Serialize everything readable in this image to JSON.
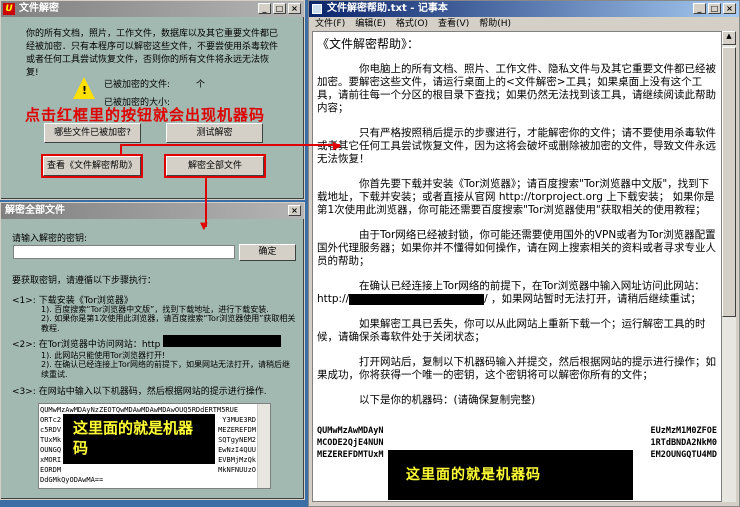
{
  "decryptor": {
    "title": "文件解密",
    "intro": "你的所有文档，照片，工作文件，数据库以及其它重要文件都已经被加密．只有本程序可以解密这些文件，不要尝使用杀毒软件或者任何工具尝试恢复文件，否则你的所有文件将永远无法恢复!",
    "files_label": "已被加密的文件:",
    "files_unit": "个",
    "size_label": "已被加密的大小:",
    "annotation": "点击红框里的按钮就会出现机器码",
    "btn_which": "哪些文件已被加密?",
    "btn_test": "测试解密",
    "btn_help": "查看《文件解密帮助》",
    "btn_decrypt_all": "解密全部文件"
  },
  "dialog": {
    "title": "解密全部文件",
    "key_label": "请输入解密的密钥:",
    "key_value": "",
    "ok": "确定",
    "steps_intro": "要获取密钥，请遵循以下步骤执行：",
    "step1": "<1>:  下载安装《Tor浏览器》",
    "step1_1": "1).  百度搜索“Tor浏览器中文版”，找到下载地址，进行下载安装.",
    "step1_2": "2).  如果你是第1次使用此浏览器，请百度搜索“Tor浏览器使用”获取相关教程.",
    "step2": "<2>:  在Tor浏览器中访问网站：http",
    "step2_1": "1).  此网站只能使用Tor浏览器打开!",
    "step2_2": "2).  在确认已经连接上Tor网络的前提下，如果网站无法打开，请稍后继续重试.",
    "step3": "<3>:  在网站中输入以下机器码，然后根据网站的提示进行操作.",
    "code_lines": [
      "QUMwMzAwMDAyNzZEOTQwMDAwMDAwMDAwOUQ5RDdERTM5RUE",
      "ORTc2",
      "c5RDV",
      "TUxMk",
      "OUNGQ",
      "xMORI",
      "EORDM",
      "DdGMkQyODAwMA=="
    ],
    "code_tail": [
      "Y3MUE3RD",
      "MEZEREFDM",
      "SQTgyNEM2",
      "EwNzI4QUU",
      "EVBMjMzQk",
      "MkNFNUUzO"
    ],
    "annotation": "这里面的就是机器码"
  },
  "notepad": {
    "title": "文件解密帮助.txt - 记事本",
    "menu": [
      "文件(F)",
      "编辑(E)",
      "格式(O)",
      "查看(V)",
      "帮助(H)"
    ],
    "heading": "《文件解密帮助》：",
    "p1": "你电脑上的所有文档、照片、工作文件、隐私文件与及其它重要文件都已经被加密。要解密这些文件，请运行桌面上的<文件解密>工具；如果桌面上没有这个工具，请前往每一个分区的根目录下查找；如果仍然无法找到该工具，请继续阅读此帮助内容；",
    "p2": "只有严格按照稍后提示的步骤进行，才能解密你的文件；请不要使用杀毒软件或者其它任何工具尝试恢复文件，因为这将会破坏或删除被加密的文件，导致文件永远无法恢复！",
    "p3": "你首先要下载并安装《Tor浏览器》；请百度搜索\"Tor浏览器中文版\"，找到下载地址，下载并安装；或者直接从官网 http://torproject.org 上下载安装； 如果你是第1次使用此浏览器，你可能还需要百度搜索\"Tor浏览器使用\"获取相关的使用教程；",
    "p4": "由于Tor网络已经被封锁，你可能还需要使用国外的VPN或者为Tor浏览器配置国外代理服务器；如果你并不懂得如何操作，请在网上搜索相关的资料或者寻求专业人员的帮助；",
    "p5a": "在确认已经连接上Tor网络的前提下，在Tor浏览器中输入网址访问此网站：http://",
    "p5b": "/ ，如果网站暂时无法打开，请稍后继续重试；",
    "p6": "如果解密工具已丢失，你可以从此网站上重新下载一个；运行解密工具的时候，请确保杀毒软件处于关闭状态；",
    "p7": "打开网站后，复制以下机器码输入并提交，然后根据网站的提示进行操作；如果成功，你将获得一个唯一的密钥，这个密钥将可以解密你所有的文件；",
    "p8": "以下是你的机器码：(请确保复制完整)",
    "code_left": [
      "QUMwMzAwMDAyN",
      "MCODE2QjE4NUN",
      "MEZEREFDMTUxM"
    ],
    "code_right": [
      "EUzMzM1M0ZFOE",
      "1RTdBNDA2NkM0",
      "EM2OUNGQTU4MD"
    ],
    "annotation": "这里面的就是机器码"
  }
}
